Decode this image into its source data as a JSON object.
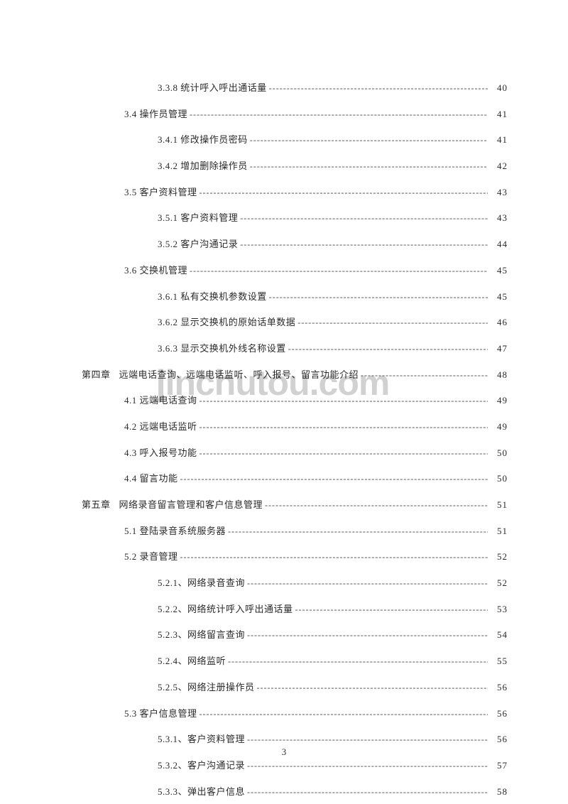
{
  "watermark": "jinchutou.com",
  "page_number": "3",
  "toc": [
    {
      "indent": 2,
      "label": "3.3.8 统计呼入呼出通话量",
      "page": "40"
    },
    {
      "indent": 1,
      "label": "3.4 操作员管理",
      "page": "41"
    },
    {
      "indent": 2,
      "label": "3.4.1 修改操作员密码",
      "page": "41"
    },
    {
      "indent": 2,
      "label": "3.4.2 增加删除操作员",
      "page": "42"
    },
    {
      "indent": 1,
      "label": "3.5 客户资料管理",
      "page": "43"
    },
    {
      "indent": 2,
      "label": "3.5.1 客户资料管理",
      "page": "43"
    },
    {
      "indent": 2,
      "label": "3.5.2 客户沟通记录",
      "page": "44"
    },
    {
      "indent": 1,
      "label": "3.6 交换机管理",
      "page": "45"
    },
    {
      "indent": 2,
      "label": "3.6.1 私有交换机参数设置",
      "page": "45"
    },
    {
      "indent": 2,
      "label": "3.6.2 显示交换机的原始话单数据",
      "page": "46"
    },
    {
      "indent": 2,
      "label": "3.6.3 显示交换机外线名称设置",
      "page": "47"
    },
    {
      "indent": 0,
      "prefix": "第四章",
      "label": "远端电话查询、远端电话监听、呼入报号、留言功能介绍",
      "page": "48"
    },
    {
      "indent": 1,
      "label": "4.1 远端电话查询",
      "page": "49"
    },
    {
      "indent": 1,
      "label": "4.2 远端电话监听",
      "page": "49"
    },
    {
      "indent": 1,
      "label": "4.3 呼入报号功能",
      "page": "50"
    },
    {
      "indent": 1,
      "label": "4.4 留言功能",
      "page": "50"
    },
    {
      "indent": 0,
      "prefix": "第五章",
      "label": "网络录音留言管理和客户信息管理",
      "page": "51"
    },
    {
      "indent": 1,
      "label": "5.1 登陆录音系统服务器",
      "page": "51"
    },
    {
      "indent": 1,
      "label": "5.2 录音管理",
      "page": "52"
    },
    {
      "indent": 2,
      "label": "5.2.1、网络录音查询",
      "page": "52"
    },
    {
      "indent": 2,
      "label": "5.2.2、网络统计呼入呼出通话量",
      "page": "53"
    },
    {
      "indent": 2,
      "label": "5.2.3、网络留言查询",
      "page": "54"
    },
    {
      "indent": 2,
      "label": "5.2.4、网络监听",
      "page": "55"
    },
    {
      "indent": 2,
      "label": "5.2.5、网络注册操作员",
      "page": "56"
    },
    {
      "indent": 1,
      "label": "5.3 客户信息管理",
      "page": "56"
    },
    {
      "indent": 2,
      "label": "5.3.1、客户资料管理",
      "page": "56"
    },
    {
      "indent": 2,
      "label": "5.3.2、客户沟通记录",
      "page": "57"
    },
    {
      "indent": 2,
      "label": "5.3.3、弹出客户信息",
      "page": "58"
    }
  ]
}
